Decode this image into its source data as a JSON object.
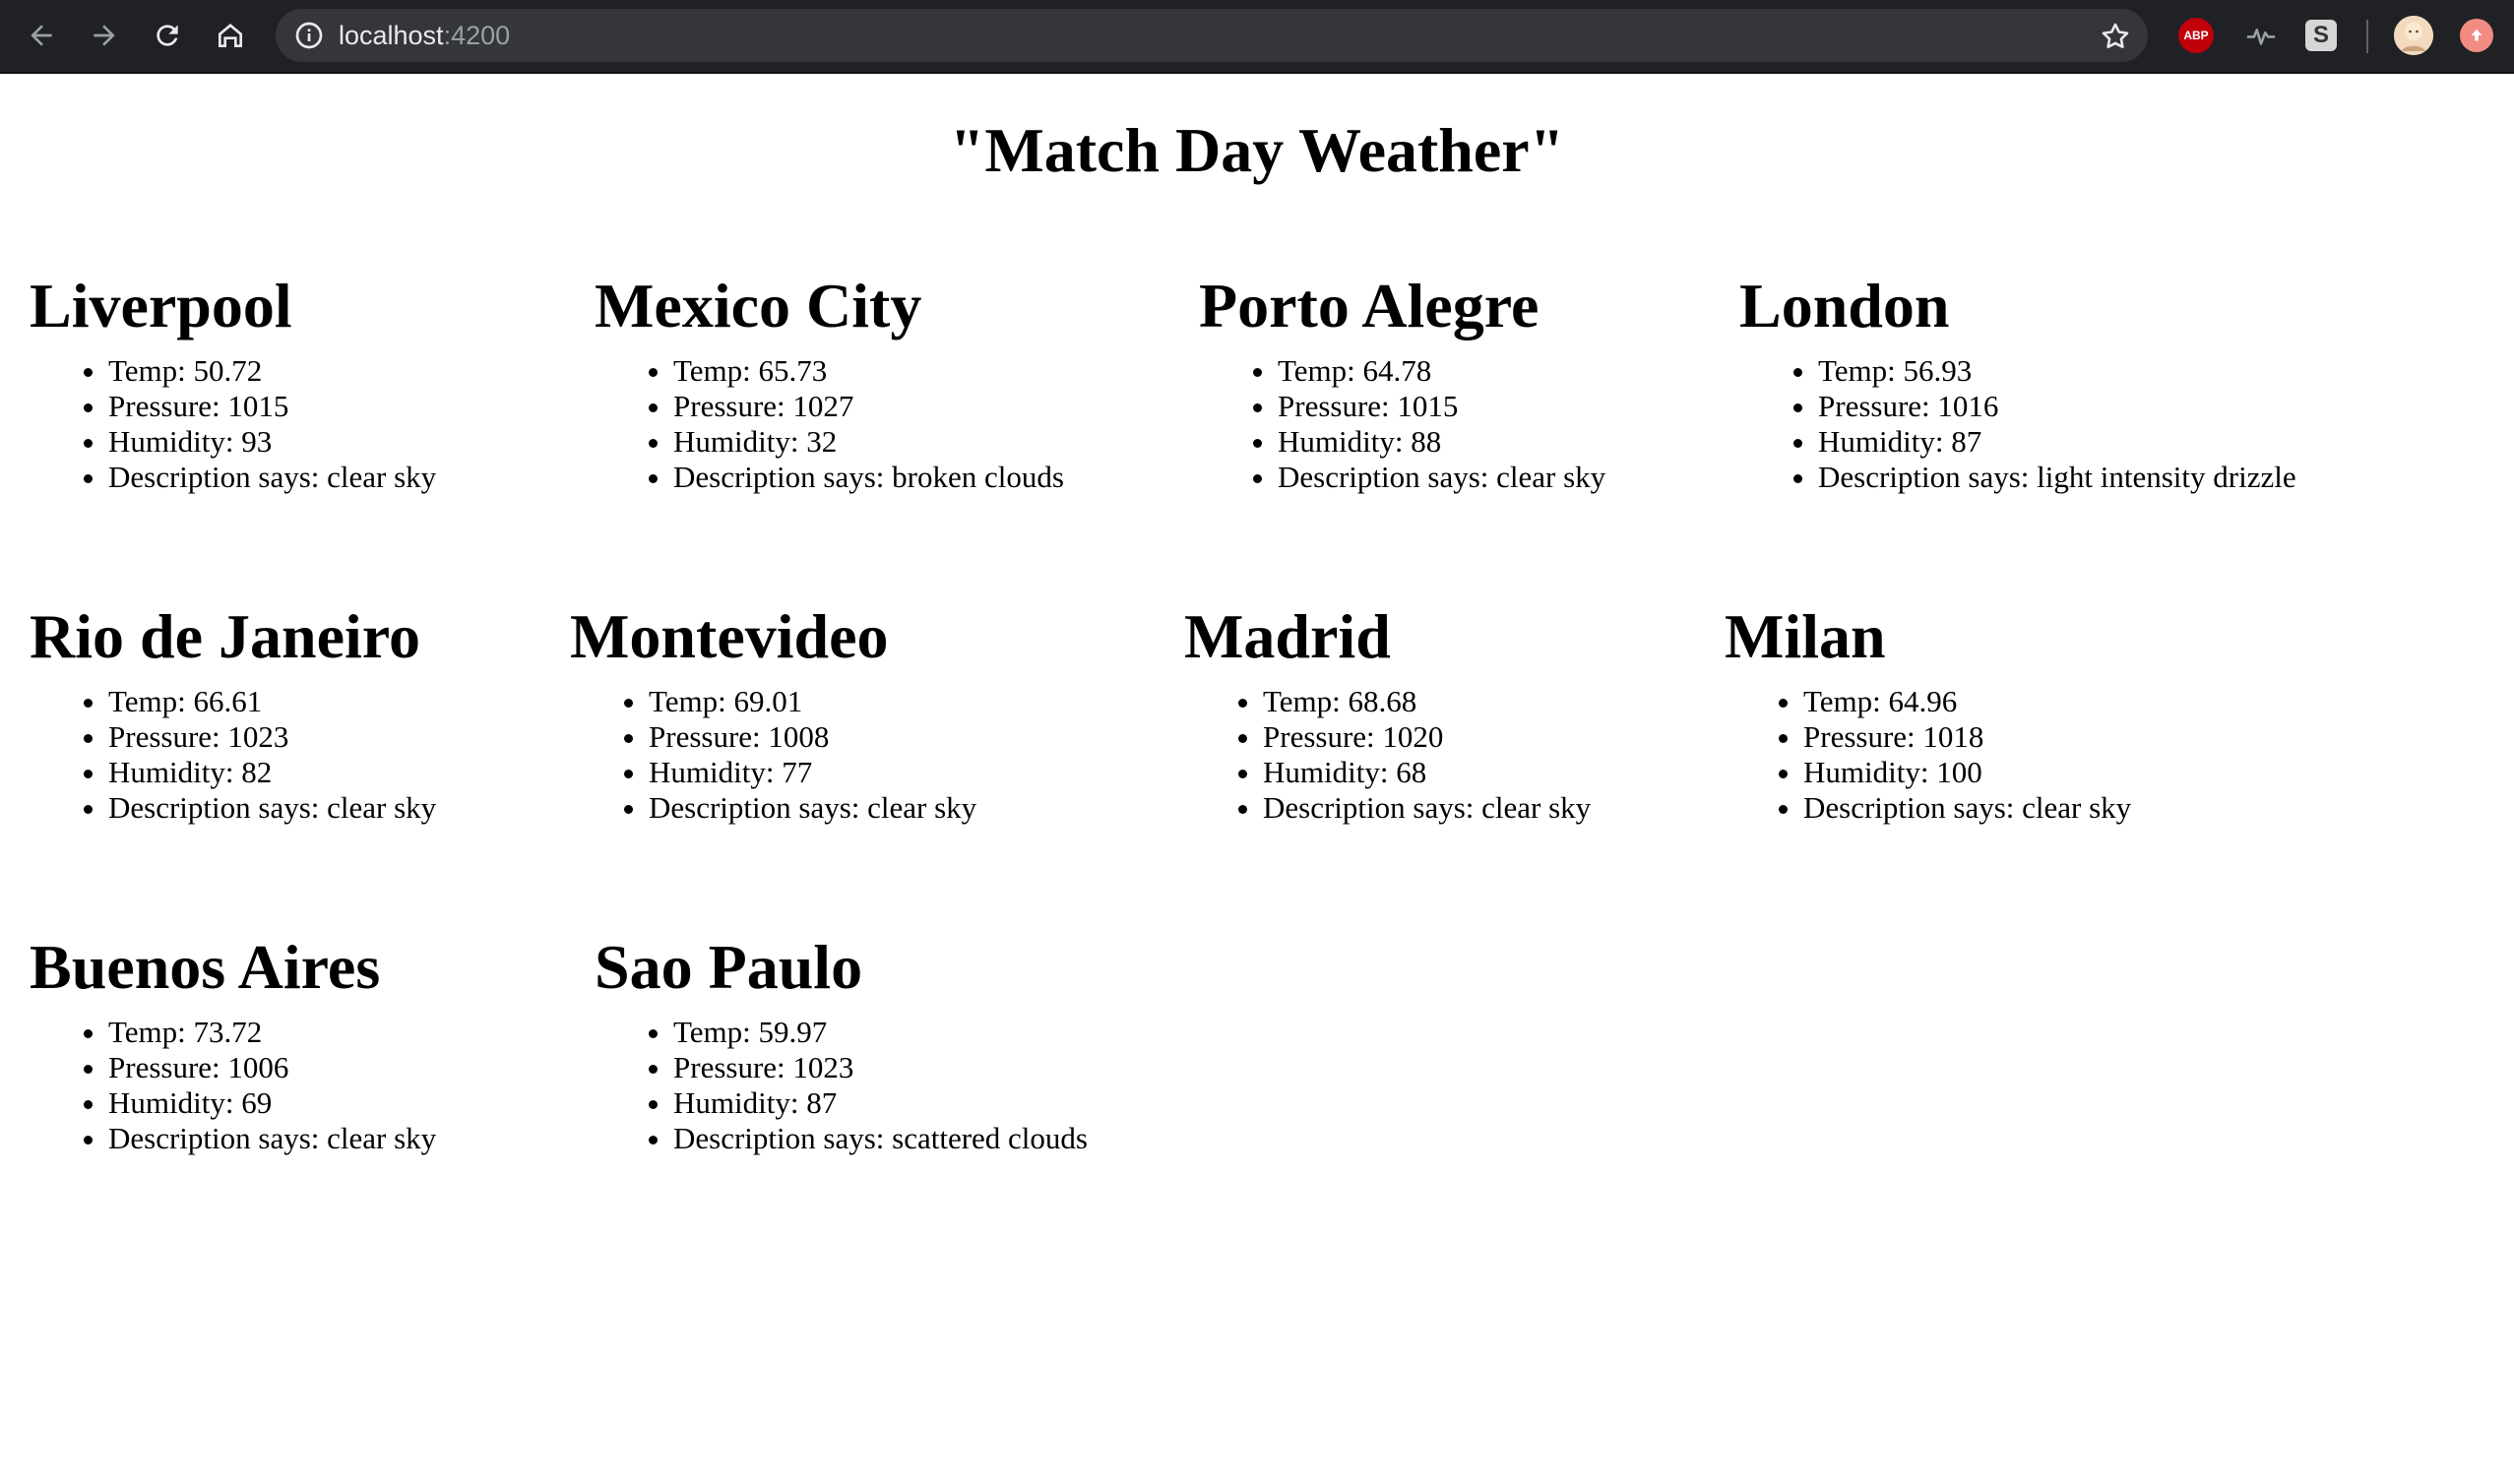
{
  "browser": {
    "url_host": "localhost",
    "url_port": ":4200",
    "icons": [
      "back-icon",
      "forward-icon",
      "reload-icon",
      "home-icon",
      "info-icon",
      "star-icon",
      "adblock-plus-icon",
      "pulse-icon",
      "s-extension-icon",
      "profile-avatar-icon",
      "update-icon"
    ],
    "abp_label": "ABP",
    "s_label": "S"
  },
  "page": {
    "title": "\"Match Day Weather\"",
    "labels": {
      "temp": "Temp: ",
      "pressure": "Pressure: ",
      "humidity": "Humidity: ",
      "description": "Description says: "
    },
    "cities": [
      {
        "name": "Liverpool",
        "temp": "50.72",
        "pressure": "1015",
        "humidity": "93",
        "description": "clear sky"
      },
      {
        "name": "Mexico City",
        "temp": "65.73",
        "pressure": "1027",
        "humidity": "32",
        "description": "broken clouds"
      },
      {
        "name": "Porto Alegre",
        "temp": "64.78",
        "pressure": "1015",
        "humidity": "88",
        "description": "clear sky"
      },
      {
        "name": "London",
        "temp": "56.93",
        "pressure": "1016",
        "humidity": "87",
        "description": "light intensity drizzle"
      },
      {
        "name": "Rio de Janeiro",
        "temp": "66.61",
        "pressure": "1023",
        "humidity": "82",
        "description": "clear sky"
      },
      {
        "name": "Montevideo",
        "temp": "69.01",
        "pressure": "1008",
        "humidity": "77",
        "description": "clear sky"
      },
      {
        "name": "Madrid",
        "temp": "68.68",
        "pressure": "1020",
        "humidity": "68",
        "description": "clear sky"
      },
      {
        "name": "Milan",
        "temp": "64.96",
        "pressure": "1018",
        "humidity": "100",
        "description": "clear sky"
      },
      {
        "name": "Buenos Aires",
        "temp": "73.72",
        "pressure": "1006",
        "humidity": "69",
        "description": "clear sky"
      },
      {
        "name": "Sao Paulo",
        "temp": "59.97",
        "pressure": "1023",
        "humidity": "87",
        "description": "scattered clouds"
      }
    ]
  }
}
